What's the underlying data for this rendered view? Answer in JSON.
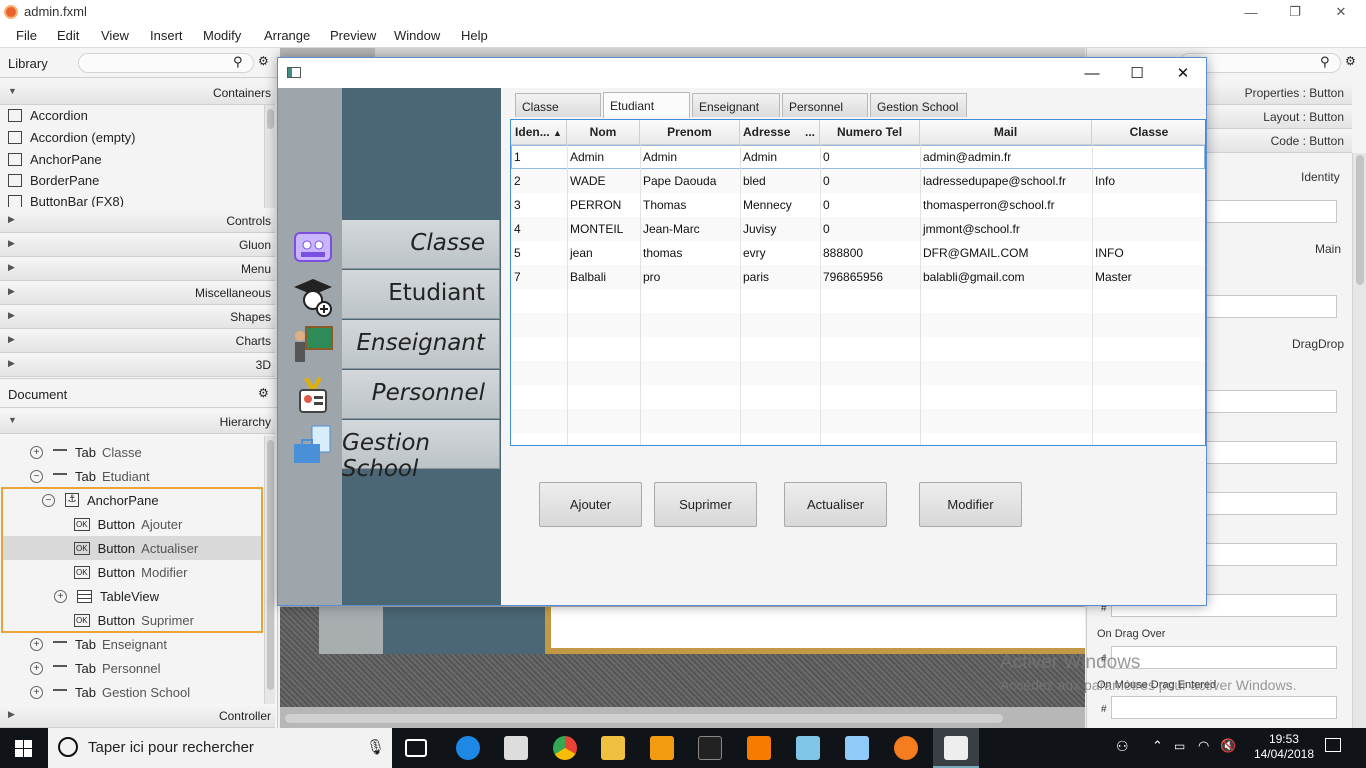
{
  "window": {
    "title": "admin.fxml"
  },
  "menubar": [
    "File",
    "Edit",
    "View",
    "Insert",
    "Modify",
    "Arrange",
    "Preview",
    "Window",
    "Help"
  ],
  "library": {
    "title": "Library",
    "containers_header": "Containers",
    "containers": [
      "Accordion",
      "Accordion  (empty)",
      "AnchorPane",
      "BorderPane",
      "ButtonBar  (FX8)"
    ],
    "sections": [
      "Controls",
      "Gluon",
      "Menu",
      "Miscellaneous",
      "Shapes",
      "Charts",
      "3D"
    ]
  },
  "document": {
    "title": "Document",
    "hierarchy_header": "Hierarchy",
    "controller_header": "Controller",
    "items": [
      {
        "type": "Tab",
        "name": "Classe",
        "expander": "+"
      },
      {
        "type": "Tab",
        "name": "Etudiant",
        "expander": "−"
      },
      {
        "type": "AnchorPane",
        "name": "",
        "expander": "−"
      },
      {
        "type": "Button",
        "name": "Ajouter",
        "expander": ""
      },
      {
        "type": "Button",
        "name": "Actualiser",
        "expander": ""
      },
      {
        "type": "Button",
        "name": "Modifier",
        "expander": ""
      },
      {
        "type": "TableView",
        "name": "",
        "expander": "+"
      },
      {
        "type": "Button",
        "name": "Suprimer",
        "expander": ""
      },
      {
        "type": "Tab",
        "name": "Enseignant",
        "expander": "+"
      },
      {
        "type": "Tab",
        "name": "Personnel",
        "expander": "+"
      },
      {
        "type": "Tab",
        "name": "Gestion School",
        "expander": "+"
      }
    ]
  },
  "inspector": {
    "properties": "Properties : Button",
    "layout": "Layout : Button",
    "code": "Code : Button",
    "identity": "Identity",
    "main": "Main",
    "dragdrop": "DragDrop",
    "on_drag_over": "On Drag Over",
    "on_mouse_drag_entered": "On Mouse Drag Entered",
    "hash": "#"
  },
  "app": {
    "nav": [
      "Classe",
      "Etudiant",
      "Enseignant",
      "Personnel",
      "Gestion School"
    ],
    "tabs": [
      "Classe",
      "Etudiant",
      "Enseignant",
      "Personnel",
      "Gestion School"
    ],
    "active_tab": "Etudiant",
    "columns": [
      "Iden...",
      "Nom",
      "Prenom",
      "Adresse",
      "Numero Tel",
      "Mail",
      "Classe"
    ],
    "adresse_menu": "...",
    "rows": [
      [
        "1",
        "Admin",
        "Admin",
        "Admin",
        "0",
        "admin@admin.fr",
        ""
      ],
      [
        "2",
        "WADE",
        "Pape Daouda",
        "bled",
        "0",
        "ladressedupape@school.fr",
        "Info"
      ],
      [
        "3",
        "PERRON",
        "Thomas",
        "Mennecy",
        "0",
        "thomasperron@school.fr",
        ""
      ],
      [
        "4",
        "MONTEIL",
        "Jean-Marc",
        "Juvisy",
        "0",
        "jmmont@school.fr",
        ""
      ],
      [
        "5",
        "jean",
        "thomas",
        "evry",
        "888800",
        "DFR@GMAIL.COM",
        "INFO"
      ],
      [
        "7",
        "Balbali",
        "pro",
        "paris",
        "796865956",
        "balabli@gmail.com",
        "Master"
      ]
    ],
    "buttons": [
      "Ajouter",
      "Suprimer",
      "Actualiser",
      "Modifier"
    ]
  },
  "watermark": {
    "line1": "Activer Windows",
    "line2": "Accédez aux paramètres pour activer Windows."
  },
  "taskbar": {
    "search_placeholder": "Taper ici pour rechercher",
    "time": "19:53",
    "date": "14/04/2018"
  },
  "colors": {
    "sidebar": "#4b6674",
    "nav_button": "#c8ced2",
    "selection_border": "#e8a33a",
    "table_focus": "#3f8fd8"
  }
}
